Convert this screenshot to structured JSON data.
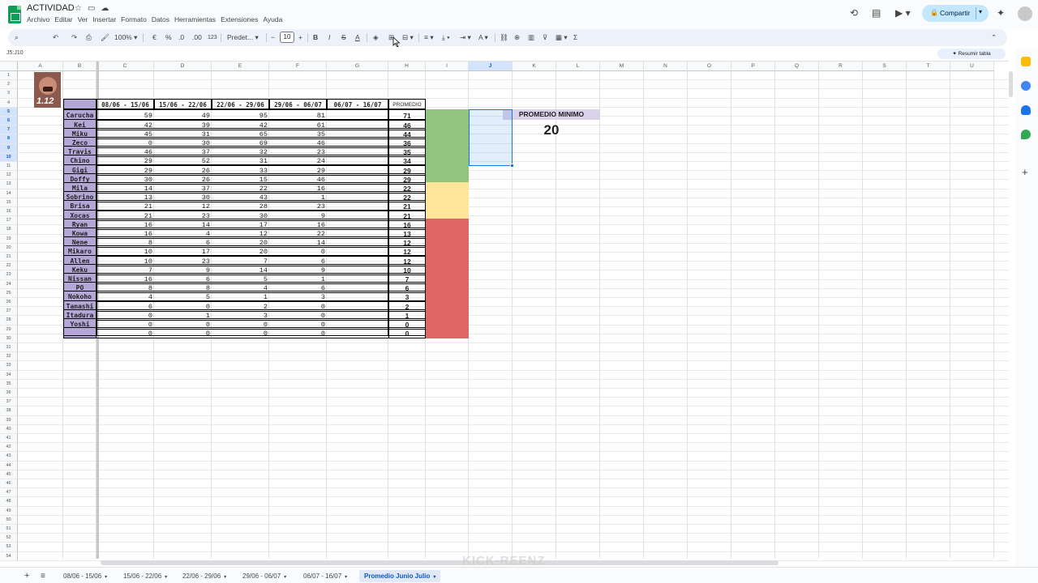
{
  "header": {
    "title": "ACTIVIDAD",
    "menu": [
      "Archivo",
      "Editar",
      "Ver",
      "Insertar",
      "Formato",
      "Datos",
      "Herramientas",
      "Extensiones",
      "Ayuda"
    ],
    "share_label": "Compartir"
  },
  "toolbar": {
    "zoom": "100%",
    "currency": "€",
    "percent": "%",
    "decimals_less": ".0",
    "decimals_more": ".00",
    "format_123": "123",
    "font": "Predet...",
    "font_size": "10",
    "minus": "−",
    "plus": "+"
  },
  "formula_bar": {
    "name_box": "J5:J10",
    "summary_button": "Resumir tabla"
  },
  "columns": [
    "A",
    "B",
    "C",
    "D",
    "E",
    "F",
    "G",
    "H",
    "I",
    "J",
    "K",
    "L",
    "M",
    "N",
    "O",
    "P",
    "Q",
    "R",
    "S",
    "T",
    "U"
  ],
  "rows_count": 54,
  "sheet": {
    "thumbnail_text": "1.12",
    "date_headers": [
      "08/06 - 15/06",
      "15/06 - 22/06",
      "22/06 - 29/06",
      "29/06 - 06/07",
      "06/07 - 16/07"
    ],
    "average_header": "PROMEDIO",
    "records": [
      {
        "name": "Carucha",
        "values": [
          59,
          49,
          95,
          81,
          ""
        ],
        "avg": 71,
        "status": "green"
      },
      {
        "name": "Kei",
        "values": [
          42,
          39,
          42,
          61,
          ""
        ],
        "avg": 46,
        "status": "green"
      },
      {
        "name": "Miku",
        "values": [
          45,
          31,
          65,
          35,
          ""
        ],
        "avg": 44,
        "status": "green"
      },
      {
        "name": "Zeco",
        "values": [
          0,
          30,
          69,
          46,
          ""
        ],
        "avg": 36,
        "status": "green"
      },
      {
        "name": "Travis",
        "values": [
          46,
          37,
          32,
          23,
          ""
        ],
        "avg": 35,
        "status": "green"
      },
      {
        "name": "Chino",
        "values": [
          29,
          52,
          31,
          24,
          ""
        ],
        "avg": 34,
        "status": "green"
      },
      {
        "name": "Gigi",
        "values": [
          29,
          26,
          33,
          29,
          ""
        ],
        "avg": 29,
        "status": "green"
      },
      {
        "name": "Doffy",
        "values": [
          30,
          26,
          15,
          46,
          ""
        ],
        "avg": 29,
        "status": "green"
      },
      {
        "name": "Mila",
        "values": [
          14,
          37,
          22,
          16,
          ""
        ],
        "avg": 22,
        "status": "yellow"
      },
      {
        "name": "Sobrino",
        "values": [
          13,
          30,
          43,
          1,
          ""
        ],
        "avg": 22,
        "status": "yellow"
      },
      {
        "name": "Brisa",
        "values": [
          21,
          12,
          28,
          23,
          ""
        ],
        "avg": 21,
        "status": "yellow"
      },
      {
        "name": "Xocas",
        "values": [
          21,
          23,
          30,
          9,
          ""
        ],
        "avg": 21,
        "status": "yellow"
      },
      {
        "name": "Ryan",
        "values": [
          16,
          14,
          17,
          16,
          ""
        ],
        "avg": 16,
        "status": "red"
      },
      {
        "name": "Kowa",
        "values": [
          16,
          4,
          12,
          22,
          ""
        ],
        "avg": 13,
        "status": "red"
      },
      {
        "name": "Nene",
        "values": [
          8,
          6,
          20,
          14,
          ""
        ],
        "avg": 12,
        "status": "red"
      },
      {
        "name": "Mikaro",
        "values": [
          10,
          17,
          20,
          0,
          ""
        ],
        "avg": 12,
        "status": "red"
      },
      {
        "name": "Allen",
        "values": [
          10,
          23,
          7,
          6,
          ""
        ],
        "avg": 12,
        "status": "red"
      },
      {
        "name": "Keku",
        "values": [
          7,
          9,
          14,
          9,
          ""
        ],
        "avg": 10,
        "status": "red"
      },
      {
        "name": "Nissan",
        "values": [
          16,
          6,
          5,
          1,
          ""
        ],
        "avg": 7,
        "status": "red"
      },
      {
        "name": "PO",
        "values": [
          8,
          8,
          4,
          6,
          ""
        ],
        "avg": 6,
        "status": "red"
      },
      {
        "name": "Nokoho",
        "values": [
          4,
          5,
          1,
          3,
          ""
        ],
        "avg": 3,
        "status": "red"
      },
      {
        "name": "Tanashi",
        "values": [
          6,
          0,
          2,
          0,
          ""
        ],
        "avg": 2,
        "status": "red"
      },
      {
        "name": "Itadura",
        "values": [
          0,
          1,
          3,
          0,
          ""
        ],
        "avg": 1,
        "status": "red"
      },
      {
        "name": "Yoshi",
        "values": [
          0,
          0,
          0,
          0,
          ""
        ],
        "avg": 0,
        "status": "red"
      },
      {
        "name": "",
        "values": [
          0,
          0,
          0,
          0,
          ""
        ],
        "avg": 0,
        "status": "red"
      }
    ],
    "min_avg_label": "PROMEDIO MINIMO",
    "min_avg_value": "20"
  },
  "colors": {
    "name_fill": "#b4a7d6",
    "green": "#93c47d",
    "yellow": "#ffe599",
    "red": "#e06666",
    "selection": "#1a73e8"
  },
  "tabs": [
    {
      "label": "08/06 - 15/06",
      "active": false
    },
    {
      "label": "15/06 - 22/06",
      "active": false
    },
    {
      "label": "22/06 - 29/06",
      "active": false
    },
    {
      "label": "29/06 - 06/07",
      "active": false
    },
    {
      "label": "06/07 - 16/07",
      "active": false
    },
    {
      "label": "Promedio Junio Julio",
      "active": true
    }
  ],
  "watermark": "KICK-REENZ"
}
